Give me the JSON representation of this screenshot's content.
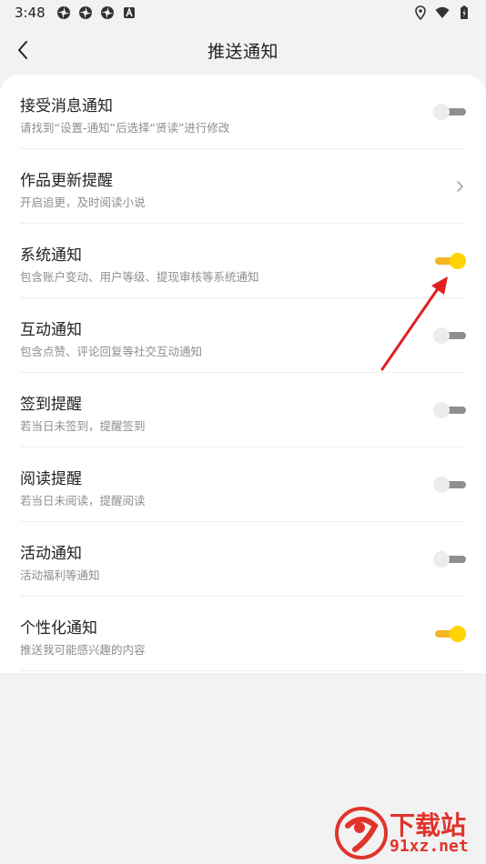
{
  "status_bar": {
    "time": "3:48",
    "left_icons": [
      "pinwheel-icon",
      "pinwheel-icon",
      "pinwheel-icon",
      "app-letter-icon"
    ],
    "right_icons": [
      "location-icon",
      "wifi-icon",
      "battery-icon"
    ]
  },
  "header": {
    "title": "推送通知",
    "back_icon": "chevron-left-icon"
  },
  "settings": {
    "items": [
      {
        "title": "接受消息通知",
        "subtitle": "请找到“设置-通知”后选择“贤读”进行修改",
        "control": "toggle",
        "enabled": false
      },
      {
        "title": "作品更新提醒",
        "subtitle": "开启追更，及时阅读小说",
        "control": "chevron"
      },
      {
        "title": "系统通知",
        "subtitle": "包含账户变动、用户等级、提现审核等系统通知",
        "control": "toggle",
        "enabled": true
      },
      {
        "title": "互动通知",
        "subtitle": "包含点赞、评论回复等社交互动通知",
        "control": "toggle",
        "enabled": false
      },
      {
        "title": "签到提醒",
        "subtitle": "若当日未签到，提醒签到",
        "control": "toggle",
        "enabled": false
      },
      {
        "title": "阅读提醒",
        "subtitle": "若当日未阅读，提醒阅读",
        "control": "toggle",
        "enabled": false
      },
      {
        "title": "活动通知",
        "subtitle": "活动福利等通知",
        "control": "toggle",
        "enabled": false
      },
      {
        "title": "个性化通知",
        "subtitle": "推送我可能感兴趣的内容",
        "control": "toggle",
        "enabled": true
      }
    ]
  },
  "colors": {
    "toggle_on_knob": "#ffd400",
    "toggle_on_track": "#f5b623",
    "toggle_off_knob": "#ececec",
    "toggle_off_track": "#8f8f8f",
    "annotation": "#e02020"
  },
  "watermark": {
    "top": "下载站",
    "bottom": "91xz.net"
  }
}
